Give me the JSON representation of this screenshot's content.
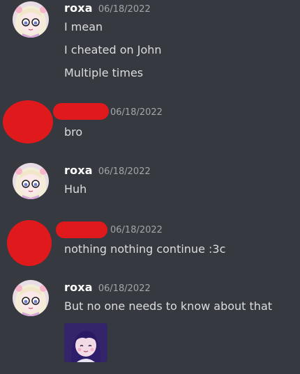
{
  "messages": [
    {
      "author": "roxa",
      "timestamp": "06/18/2022",
      "lines": [
        "I mean",
        "I cheated on John",
        "Multiple times"
      ]
    },
    {
      "author": "",
      "timestamp": "06/18/2022",
      "lines": [
        "bro"
      ]
    },
    {
      "author": "roxa",
      "timestamp": "06/18/2022",
      "lines": [
        "Huh"
      ]
    },
    {
      "author": "",
      "timestamp": "06/18/2022",
      "lines": [
        "nothing nothing continue :3c"
      ]
    },
    {
      "author": "roxa",
      "timestamp": "06/18/2022",
      "lines": [
        "But no one needs to know about that"
      ]
    }
  ],
  "icons": {
    "roxa_avatar": "anime-girl-avatar-icon",
    "attachment": "anime-character-image"
  },
  "colors": {
    "background": "#36393f",
    "text": "#dcddde",
    "username": "#ffffff",
    "timestamp": "#a3a6aa",
    "redaction": "#e0191c"
  }
}
